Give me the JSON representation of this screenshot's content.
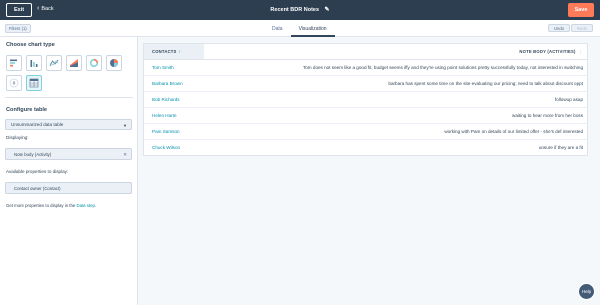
{
  "topbar": {
    "exit_label": "Exit",
    "back_label": "Back",
    "report_title": "Recent BDR Notes",
    "save_label": "Save"
  },
  "subbar": {
    "filters_label": "Filters (1)",
    "tabs": [
      {
        "label": "Data",
        "active": false
      },
      {
        "label": "Visualization",
        "active": true
      }
    ],
    "undo_label": "Undo",
    "redo_label": "Redo"
  },
  "left_panel": {
    "chart_type_title": "Choose chart type",
    "chart_types": [
      {
        "icon": "horizontal-bar-chart-icon",
        "selected": false
      },
      {
        "icon": "vertical-bar-chart-icon",
        "selected": false
      },
      {
        "icon": "line-chart-icon",
        "selected": false
      },
      {
        "icon": "area-chart-icon",
        "selected": false
      },
      {
        "icon": "donut-chart-icon",
        "selected": false
      },
      {
        "icon": "pie-chart-icon",
        "selected": false
      },
      {
        "icon": "summary-number-icon",
        "selected": false
      },
      {
        "icon": "table-chart-icon",
        "selected": true
      }
    ],
    "configure_title": "Configure table",
    "table_type_value": "Unsummarized data table",
    "displaying_label": "Displaying:",
    "displayed_property": "Note body (Activity)",
    "available_label": "Available properties to display:",
    "available_property": "Contact owner (Contact)",
    "get_more_text": "Get more properties to display in the ",
    "get_more_link": "Data step",
    "get_more_end": "."
  },
  "table": {
    "col_contacts": "CONTACTS",
    "col_note": "NOTE BODY (ACTIVITIES)",
    "rows": [
      {
        "name": "Tom Smith",
        "note": "Tom does not seem like a good fit, budget seems iffy and they're using point solutions pretty successfully today, not interested in switching"
      },
      {
        "name": "Barbara Brown",
        "note": "barbara has spent some time on the site evaluating our pricing; need to talk about discount oppt"
      },
      {
        "name": "Bob Richards",
        "note": "followup asap"
      },
      {
        "name": "Helen Harte",
        "note": "waiting to hear more from her boss"
      },
      {
        "name": "Pam Samson",
        "note": "working with Pam on details of our limited offer - she's def interested"
      },
      {
        "name": "Chuck Wilson",
        "note": "unsure if they are a fit"
      }
    ]
  },
  "help_label": "Help",
  "colors": {
    "topbar": "#2d3e50",
    "accent": "#ff7a59",
    "link": "#0091ae"
  }
}
